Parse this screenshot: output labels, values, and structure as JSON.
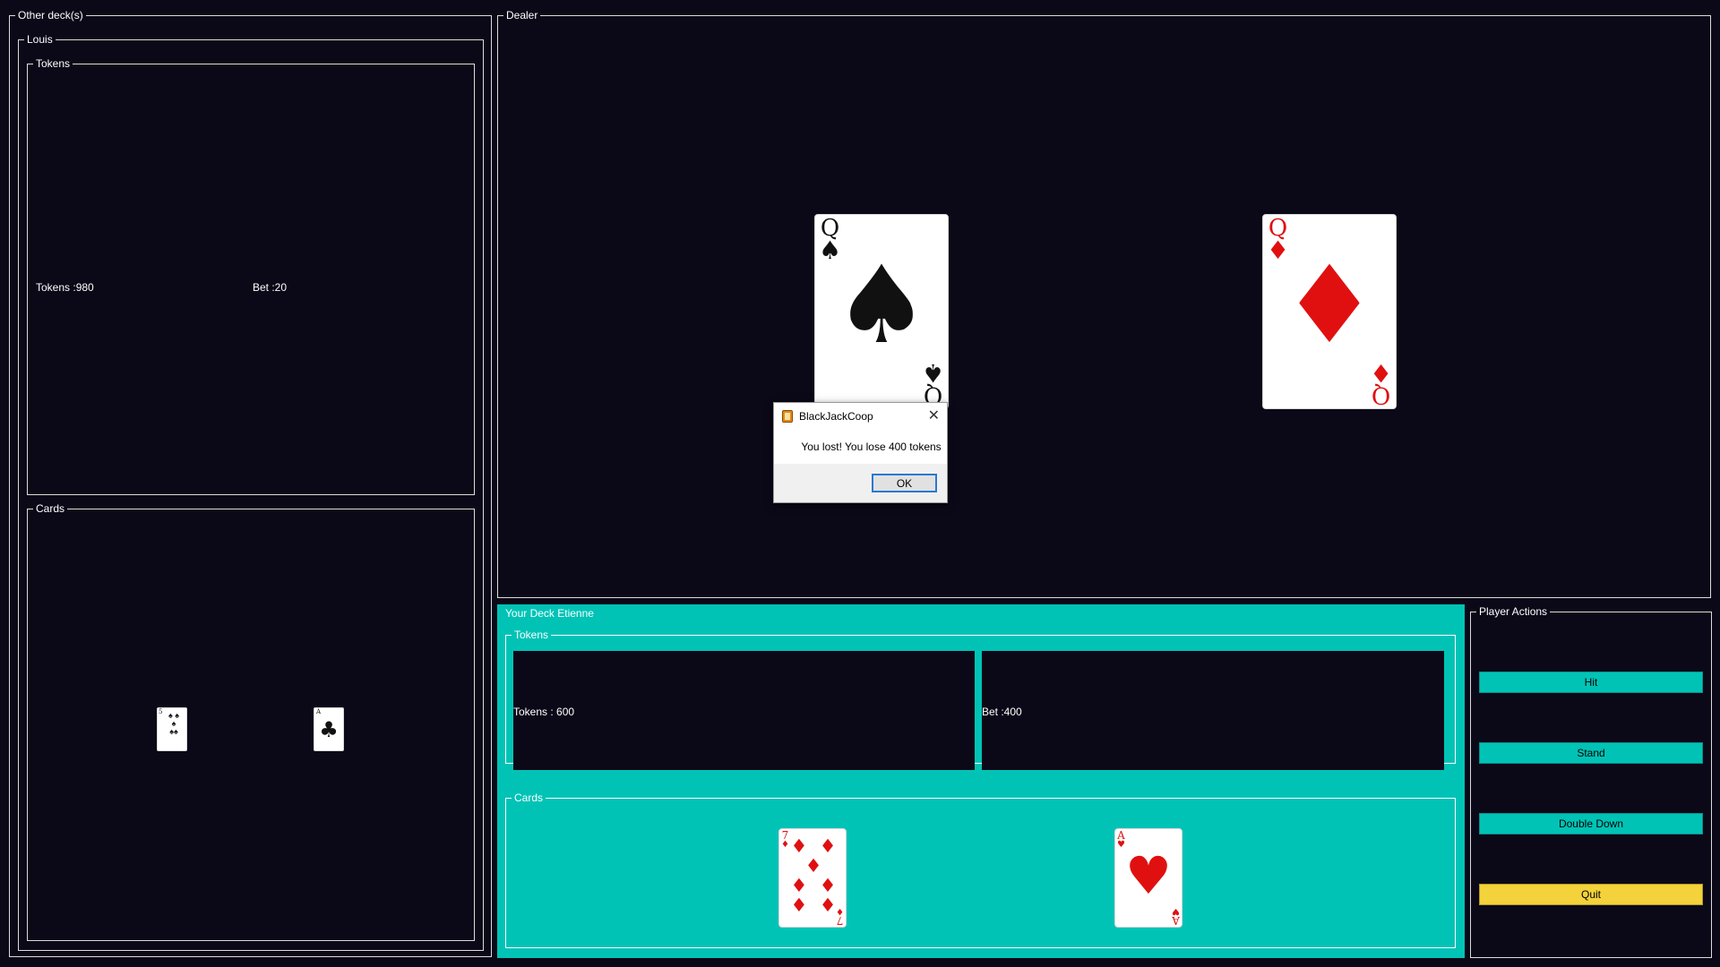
{
  "other_decks": {
    "legend": "Other deck(s)",
    "player": {
      "name": "Louis",
      "tokens_legend": "Tokens",
      "tokens_text": "Tokens :980",
      "bet_text": "Bet :20",
      "cards_legend": "Cards",
      "cards": [
        {
          "rank": "5",
          "suit": "♠",
          "color": "black"
        },
        {
          "rank": "A",
          "suit": "♣",
          "color": "black"
        }
      ]
    }
  },
  "dealer": {
    "legend": "Dealer",
    "cards": [
      {
        "rank": "Q",
        "suit": "♠",
        "color": "black"
      },
      {
        "rank": "Q",
        "suit": "♦",
        "color": "red"
      }
    ]
  },
  "your_deck": {
    "legend": "Your Deck Etienne",
    "tokens_legend": "Tokens",
    "tokens_text": "Tokens : 600",
    "bet_text": "Bet :400",
    "cards_legend": "Cards",
    "cards": [
      {
        "rank": "7",
        "suit": "♦",
        "color": "red"
      },
      {
        "rank": "A",
        "suit": "♥",
        "color": "red"
      }
    ]
  },
  "player_actions": {
    "legend": "Player Actions",
    "hit": "Hit",
    "stand": "Stand",
    "double_down": "Double Down",
    "quit": "Quit"
  },
  "dialog": {
    "title": "BlackJackCoop",
    "message": "You lost! You lose 400 tokens",
    "ok": "OK",
    "close_icon": "✕"
  },
  "colors": {
    "background": "#0b0818",
    "teal": "#00c3b6",
    "quit_yellow": "#f3d23b",
    "card_red": "#e01010",
    "card_black": "#111111"
  }
}
